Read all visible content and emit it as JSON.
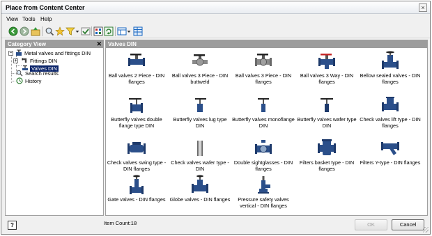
{
  "window": {
    "title": "Place from Content Center",
    "close_glyph": "×"
  },
  "menu": [
    "View",
    "Tools",
    "Help"
  ],
  "toolbar": {
    "buttons": [
      "back-icon",
      "forward-icon",
      "up-folder-icon",
      "search-icon",
      "favorites-star-icon",
      "filter-icon",
      "check-icon",
      "table-view-icon",
      "refresh-icon",
      "view-options-icon",
      "details-view-icon"
    ]
  },
  "category_view": {
    "header": "Category View",
    "close_glyph": "✕",
    "tree": [
      {
        "label": "Metal valves and fittings DIN",
        "expander": "−",
        "icon": "valve-folder-icon"
      },
      {
        "label": "Fittings DIN",
        "expander": "+",
        "icon": "fitting-icon"
      },
      {
        "label": "Valves DIN",
        "icon": "valve-icon",
        "selected": true
      },
      {
        "label": "Search results",
        "icon": "search-icon"
      },
      {
        "label": "History",
        "icon": "history-icon"
      }
    ]
  },
  "content": {
    "header": "Valves DIN",
    "items": [
      {
        "label": "Ball valves 2 Piece - DIN flanges",
        "icon": "ball-valve-icon"
      },
      {
        "label": "Ball valves 3 Piece - DIN buttweld",
        "icon": "ball-valve-icon"
      },
      {
        "label": "Ball valves 3 Piece - DIN flanges",
        "icon": "ball-valve-icon"
      },
      {
        "label": "Ball valves 3 Way - DIN flanges",
        "icon": "ball-valve-3way-icon"
      },
      {
        "label": "Bellow sealed valves - DIN flanges",
        "icon": "bellow-valve-icon"
      },
      {
        "label": "Butterfly valves double flange type DIN",
        "icon": "butterfly-valve-icon"
      },
      {
        "label": "Butterfly valves lug type DIN",
        "icon": "butterfly-valve-icon"
      },
      {
        "label": "Butterfly valves monoflange DIN",
        "icon": "butterfly-valve-icon"
      },
      {
        "label": "Butterfly valves wafer type DIN",
        "icon": "butterfly-valve-icon"
      },
      {
        "label": "Check valves lift type - DIN flanges",
        "icon": "check-valve-icon"
      },
      {
        "label": "Check valves swing type - DIN flanges",
        "icon": "check-valve-icon"
      },
      {
        "label": "Check valves wafer type - DIN",
        "icon": "wafer-check-valve-icon"
      },
      {
        "label": "Double sightglasses - DIN flanges",
        "icon": "sightglass-icon"
      },
      {
        "label": "Filters basket type - DIN flanges",
        "icon": "filter-basket-icon"
      },
      {
        "label": "Filters Y-type - DIN flanges",
        "icon": "y-filter-icon"
      },
      {
        "label": "Gate valves - DIN flanges",
        "icon": "gate-valve-icon"
      },
      {
        "label": "Globe valves - DIN flanges",
        "icon": "globe-valve-icon"
      },
      {
        "label": "Pressure safety valves vertical - DIN flanges",
        "icon": "safety-valve-icon"
      }
    ]
  },
  "status": {
    "item_count": "Item Count:18",
    "help_glyph": "?",
    "ok_label": "OK",
    "cancel_label": "Cancel"
  },
  "colors": {
    "valve_blue": "#2b4f8a",
    "handle_red": "#c62828",
    "selection": "#0a246a",
    "header_gray": "#9c9c9c"
  }
}
